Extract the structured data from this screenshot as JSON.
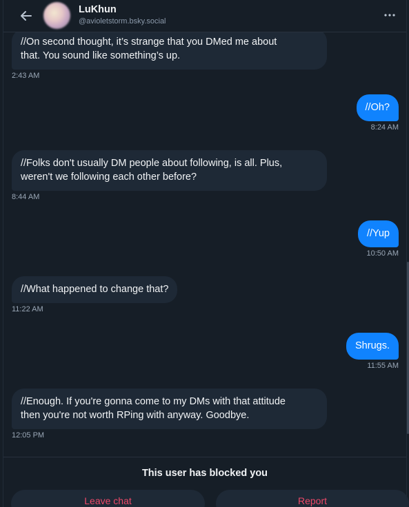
{
  "header": {
    "name": "LuKhun",
    "handle": "@avioletstorm.bsky.social"
  },
  "messages": [
    {
      "direction": "incoming",
      "lines": [
        "//On second thought, it’s strange that you DMed me about",
        "that. You sound like something’s up."
      ],
      "time": "2:43 AM"
    },
    {
      "direction": "outgoing",
      "lines": [
        "//Oh?"
      ],
      "time": "8:24 AM"
    },
    {
      "direction": "incoming",
      "lines": [
        "//Folks don't usually DM people about following, is all. Plus,",
        "weren't we following each other before?"
      ],
      "time": "8:44 AM"
    },
    {
      "direction": "outgoing",
      "lines": [
        "//Yup"
      ],
      "time": "10:50 AM"
    },
    {
      "direction": "incoming",
      "lines": [
        "//What happened to change that?"
      ],
      "time": "11:22 AM"
    },
    {
      "direction": "outgoing",
      "lines": [
        "Shrugs."
      ],
      "time": "11:55 AM"
    },
    {
      "direction": "incoming",
      "lines": [
        "//Enough. If you're gonna come to my DMs with that attitude",
        "then you're not worth RPing with anyway. Goodbye."
      ],
      "time": "12:05 PM"
    }
  ],
  "footer": {
    "blocked_notice": "This user has blocked you",
    "leave_label": "Leave chat",
    "report_label": "Report"
  },
  "colors": {
    "accent": "#1083fe",
    "danger": "#ec4868",
    "incoming_bubble": "#1e2936",
    "background": "#161e27"
  }
}
